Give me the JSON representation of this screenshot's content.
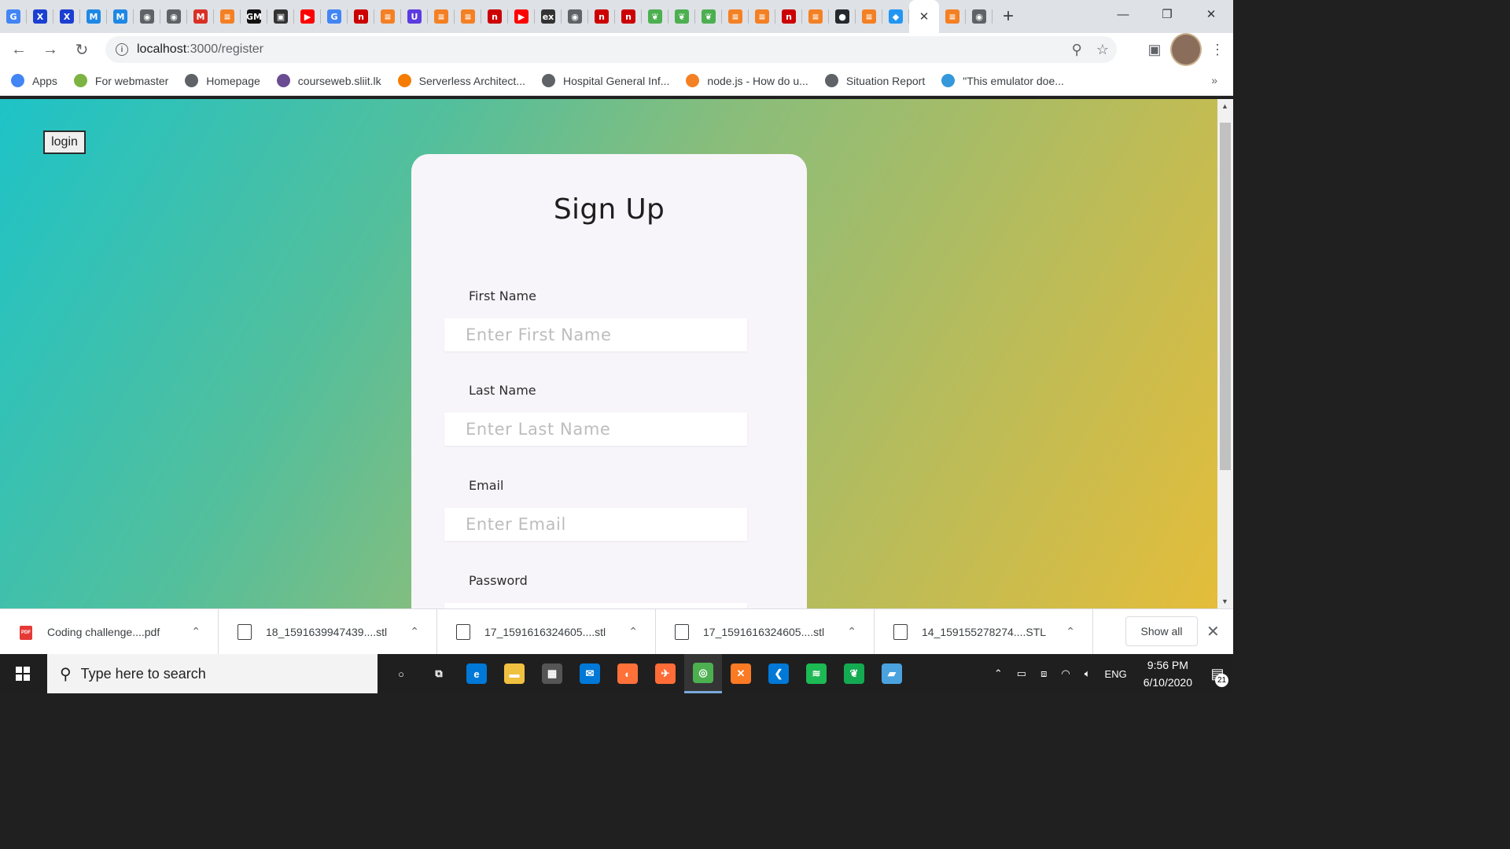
{
  "browser": {
    "tabs": [
      {
        "icon": "google-icon",
        "glyph": "G",
        "color": "#4285f4"
      },
      {
        "icon": "xampp-icon",
        "glyph": "X",
        "color": "#1a3fd1"
      },
      {
        "icon": "xampp-icon",
        "glyph": "X",
        "color": "#1a3fd1"
      },
      {
        "icon": "mui-icon",
        "glyph": "M",
        "color": "#1e88e5"
      },
      {
        "icon": "mui-icon",
        "glyph": "M",
        "color": "#1e88e5"
      },
      {
        "icon": "globe-icon",
        "glyph": "◉",
        "color": "#5f6368"
      },
      {
        "icon": "globe-icon",
        "glyph": "◉",
        "color": "#5f6368"
      },
      {
        "icon": "gmail-icon",
        "glyph": "M",
        "color": "#d93025"
      },
      {
        "icon": "stackoverflow-icon",
        "glyph": "≡",
        "color": "#f48024"
      },
      {
        "icon": "gm-icon",
        "glyph": "GM",
        "color": "#111111"
      },
      {
        "icon": "codesandbox-icon",
        "glyph": "▣",
        "color": "#333333"
      },
      {
        "icon": "youtube-icon",
        "glyph": "▶",
        "color": "#ff0000"
      },
      {
        "icon": "google-icon",
        "glyph": "G",
        "color": "#4285f4"
      },
      {
        "icon": "n-icon",
        "glyph": "n",
        "color": "#cc0000"
      },
      {
        "icon": "stackoverflow-icon",
        "glyph": "≡",
        "color": "#f48024"
      },
      {
        "icon": "u-icon",
        "glyph": "U",
        "color": "#5c3be0"
      },
      {
        "icon": "stackoverflow-icon",
        "glyph": "≡",
        "color": "#f48024"
      },
      {
        "icon": "stackoverflow-icon",
        "glyph": "≡",
        "color": "#f48024"
      },
      {
        "icon": "n-icon",
        "glyph": "n",
        "color": "#cc0000"
      },
      {
        "icon": "youtube-icon",
        "glyph": "▶",
        "color": "#ff0000"
      },
      {
        "icon": "ex-icon",
        "glyph": "ex",
        "color": "#333333"
      },
      {
        "icon": "globe-icon",
        "glyph": "◉",
        "color": "#5f6368"
      },
      {
        "icon": "n-icon",
        "glyph": "n",
        "color": "#cc0000"
      },
      {
        "icon": "n-icon",
        "glyph": "n",
        "color": "#cc0000"
      },
      {
        "icon": "mongodb-icon",
        "glyph": "❦",
        "color": "#4caf50"
      },
      {
        "icon": "mongodb-icon",
        "glyph": "❦",
        "color": "#4caf50"
      },
      {
        "icon": "mongodb-icon",
        "glyph": "❦",
        "color": "#4caf50"
      },
      {
        "icon": "stackoverflow-icon",
        "glyph": "≡",
        "color": "#f48024"
      },
      {
        "icon": "stackoverflow-icon",
        "glyph": "≡",
        "color": "#f48024"
      },
      {
        "icon": "n-icon",
        "glyph": "n",
        "color": "#cc0000"
      },
      {
        "icon": "stackoverflow-icon",
        "glyph": "≡",
        "color": "#f48024"
      },
      {
        "icon": "github-icon",
        "glyph": "●",
        "color": "#24292e"
      },
      {
        "icon": "stackoverflow-icon",
        "glyph": "≡",
        "color": "#f48024"
      },
      {
        "icon": "flutter-icon",
        "glyph": "◆",
        "color": "#2196f3"
      }
    ],
    "active_tab_close": "✕",
    "tabs_after": [
      {
        "icon": "stackoverflow-icon",
        "glyph": "≡",
        "color": "#f48024"
      },
      {
        "icon": "globe-icon",
        "glyph": "◉",
        "color": "#5f6368"
      }
    ],
    "new_tab_label": "+",
    "url_host": "localhost",
    "url_path": ":3000/register",
    "bookmarks": [
      {
        "label": "Apps",
        "icon": "apps-icon",
        "color": "#4285f4"
      },
      {
        "label": "For webmaster",
        "icon": "android-icon",
        "color": "#7cb342"
      },
      {
        "label": "Homepage",
        "icon": "globe-icon",
        "color": "#5f6368"
      },
      {
        "label": "courseweb.sliit.lk",
        "icon": "sliit-icon",
        "color": "#6a4c93"
      },
      {
        "label": "Serverless Architect...",
        "icon": "aws-icon",
        "color": "#f57c00"
      },
      {
        "label": "Hospital General Inf...",
        "icon": "globe-icon",
        "color": "#5f6368"
      },
      {
        "label": "node.js - How do u...",
        "icon": "stackoverflow-icon",
        "color": "#f48024"
      },
      {
        "label": "Situation Report",
        "icon": "globe-icon",
        "color": "#5f6368"
      },
      {
        "label": "\"This emulator doe...",
        "icon": "xamarin-icon",
        "color": "#3498db"
      }
    ],
    "bookmarks_more": "»"
  },
  "page": {
    "login_label": "login",
    "title": "Sign Up",
    "fields": [
      {
        "label": "First Name",
        "placeholder": "Enter First Name"
      },
      {
        "label": "Last Name",
        "placeholder": "Enter Last Name"
      },
      {
        "label": "Email",
        "placeholder": "Enter Email"
      },
      {
        "label": "Password",
        "placeholder": ""
      }
    ],
    "gradient": [
      "#1ec3c7",
      "#8bbd7a",
      "#e4bd3a"
    ]
  },
  "downloads": {
    "items": [
      {
        "name": "Coding challenge....pdf",
        "type": "pdf"
      },
      {
        "name": "18_1591639947439....stl",
        "type": "stl"
      },
      {
        "name": "17_1591616324605....stl",
        "type": "stl"
      },
      {
        "name": "17_1591616324605....stl",
        "type": "stl"
      },
      {
        "name": "14_159155278274....STL",
        "type": "stl"
      }
    ],
    "show_all": "Show all"
  },
  "taskbar": {
    "search_placeholder": "Type here to search",
    "apps": [
      {
        "icon": "cortana-icon",
        "glyph": "○",
        "color": "#1f1f1f"
      },
      {
        "icon": "task-view-icon",
        "glyph": "⧉",
        "color": "#1f1f1f"
      },
      {
        "icon": "edge-icon",
        "glyph": "e",
        "color": "#0078d7"
      },
      {
        "icon": "file-explorer-icon",
        "glyph": "▬",
        "color": "#f0c040"
      },
      {
        "icon": "store-icon",
        "glyph": "▦",
        "color": "#555555"
      },
      {
        "icon": "mail-icon",
        "glyph": "✉",
        "color": "#0078d7"
      },
      {
        "icon": "firefox-icon",
        "glyph": "◐",
        "color": "#ff7139"
      },
      {
        "icon": "postman-icon",
        "glyph": "✈",
        "color": "#ff6c37"
      },
      {
        "icon": "chrome-icon",
        "glyph": "◎",
        "color": "#4caf50"
      },
      {
        "icon": "xampp-icon",
        "glyph": "✕",
        "color": "#fb7a24"
      },
      {
        "icon": "vscode-icon",
        "glyph": "❮",
        "color": "#0078d7"
      },
      {
        "icon": "spotify-icon",
        "glyph": "≋",
        "color": "#1db954"
      },
      {
        "icon": "mongodb-compass-icon",
        "glyph": "❦",
        "color": "#13aa52"
      },
      {
        "icon": "notepad-icon",
        "glyph": "▰",
        "color": "#4aa3df"
      }
    ],
    "language": "ENG",
    "time": "9:56 PM",
    "date": "6/10/2020",
    "notifications": "21"
  }
}
